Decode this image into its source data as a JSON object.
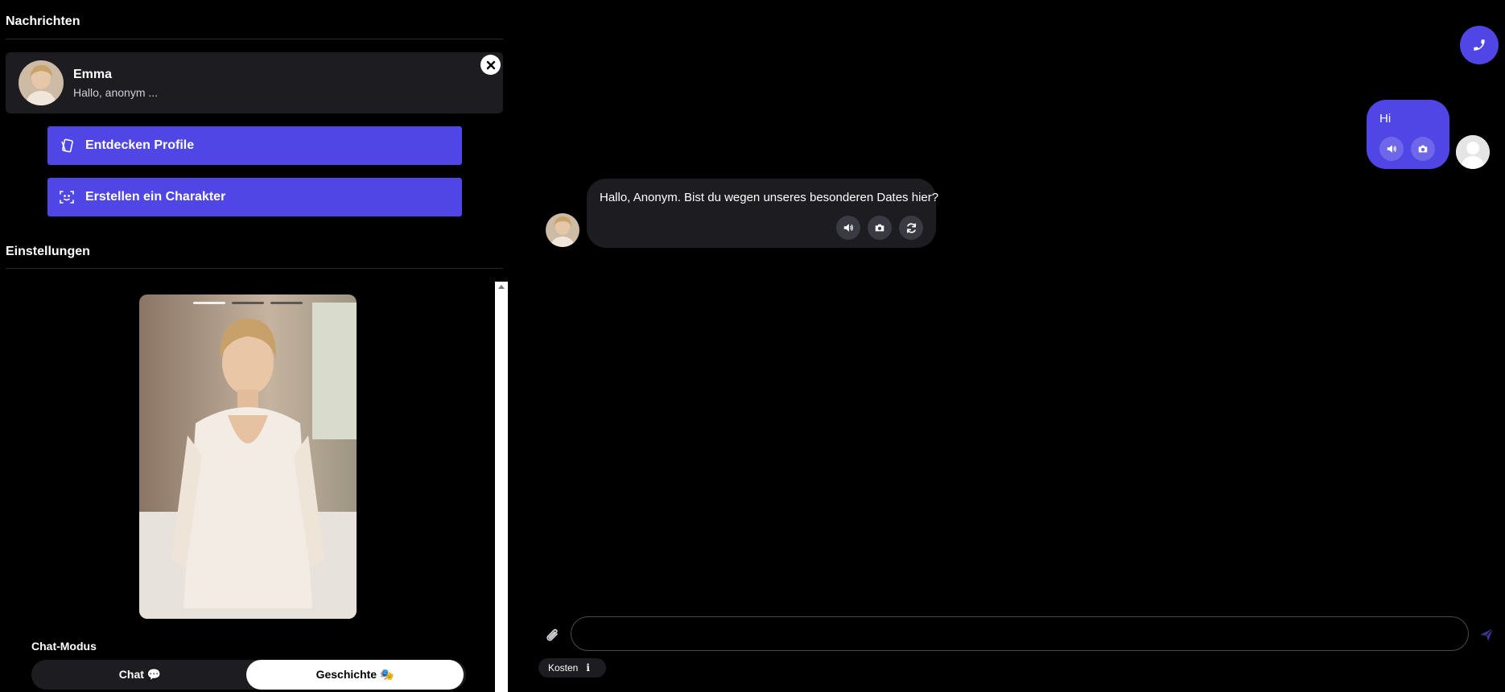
{
  "sidebar": {
    "messages_title": "Nachrichten",
    "conversation": {
      "name": "Emma",
      "preview": "Hallo, anonym ..."
    },
    "discover_label": "Entdecken Profile",
    "create_label": "Erstellen ein Charakter",
    "settings_title": "Einstellungen",
    "story_progress": {
      "count": 3,
      "active_index": 0
    },
    "chat_mode": {
      "label": "Chat-Modus",
      "options": [
        "Chat 💬",
        "Geschichte 🎭"
      ],
      "selected": "Geschichte 🎭"
    }
  },
  "chat": {
    "messages": [
      {
        "from": "user",
        "text": "Hi"
      },
      {
        "from": "bot",
        "text": "Hallo, Anonym. Bist du wegen unseres besonderen Dates hier?"
      }
    ],
    "input": {
      "value": "",
      "placeholder": ""
    },
    "cost_label": "Kosten"
  },
  "colors": {
    "accent": "#4f46e5",
    "background": "#000000",
    "card": "#1c1c21",
    "text": "#ffffff"
  },
  "icons": {
    "close": "close-icon",
    "discover": "cards-icon",
    "create": "scan-face-icon",
    "call": "phone-icon",
    "speaker": "speaker-icon",
    "camera": "camera-icon",
    "regenerate": "refresh-icon",
    "attach": "paperclip-icon",
    "send": "send-icon",
    "info": "info-icon"
  }
}
